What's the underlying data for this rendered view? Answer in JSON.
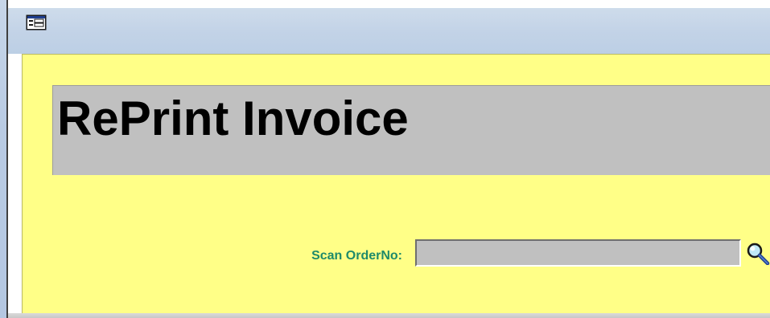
{
  "window": {
    "icon": "form-icon"
  },
  "form": {
    "title": "RePrint Invoice",
    "scan_label": "Scan OrderNo:",
    "scan_value": "",
    "lookup_icon": "magnifier-icon",
    "colors": {
      "background": "#ffff87",
      "banner": "#c0c0c0",
      "label": "#1e8a6a",
      "input": "#c0c0c0"
    }
  }
}
